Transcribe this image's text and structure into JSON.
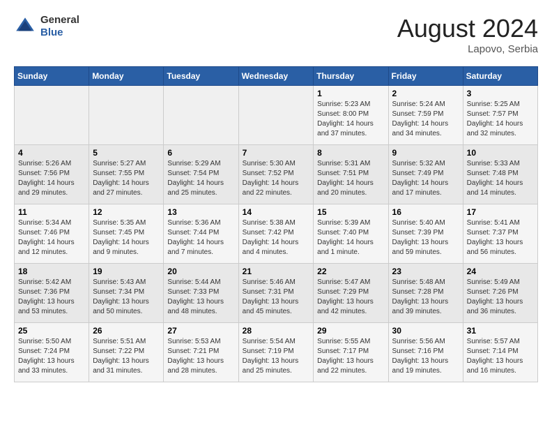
{
  "header": {
    "logo_general": "General",
    "logo_blue": "Blue",
    "month_year": "August 2024",
    "location": "Lapovo, Serbia"
  },
  "weekdays": [
    "Sunday",
    "Monday",
    "Tuesday",
    "Wednesday",
    "Thursday",
    "Friday",
    "Saturday"
  ],
  "weeks": [
    [
      {
        "day": "",
        "details": ""
      },
      {
        "day": "",
        "details": ""
      },
      {
        "day": "",
        "details": ""
      },
      {
        "day": "",
        "details": ""
      },
      {
        "day": "1",
        "details": "Sunrise: 5:23 AM\nSunset: 8:00 PM\nDaylight: 14 hours\nand 37 minutes."
      },
      {
        "day": "2",
        "details": "Sunrise: 5:24 AM\nSunset: 7:59 PM\nDaylight: 14 hours\nand 34 minutes."
      },
      {
        "day": "3",
        "details": "Sunrise: 5:25 AM\nSunset: 7:57 PM\nDaylight: 14 hours\nand 32 minutes."
      }
    ],
    [
      {
        "day": "4",
        "details": "Sunrise: 5:26 AM\nSunset: 7:56 PM\nDaylight: 14 hours\nand 29 minutes."
      },
      {
        "day": "5",
        "details": "Sunrise: 5:27 AM\nSunset: 7:55 PM\nDaylight: 14 hours\nand 27 minutes."
      },
      {
        "day": "6",
        "details": "Sunrise: 5:29 AM\nSunset: 7:54 PM\nDaylight: 14 hours\nand 25 minutes."
      },
      {
        "day": "7",
        "details": "Sunrise: 5:30 AM\nSunset: 7:52 PM\nDaylight: 14 hours\nand 22 minutes."
      },
      {
        "day": "8",
        "details": "Sunrise: 5:31 AM\nSunset: 7:51 PM\nDaylight: 14 hours\nand 20 minutes."
      },
      {
        "day": "9",
        "details": "Sunrise: 5:32 AM\nSunset: 7:49 PM\nDaylight: 14 hours\nand 17 minutes."
      },
      {
        "day": "10",
        "details": "Sunrise: 5:33 AM\nSunset: 7:48 PM\nDaylight: 14 hours\nand 14 minutes."
      }
    ],
    [
      {
        "day": "11",
        "details": "Sunrise: 5:34 AM\nSunset: 7:46 PM\nDaylight: 14 hours\nand 12 minutes."
      },
      {
        "day": "12",
        "details": "Sunrise: 5:35 AM\nSunset: 7:45 PM\nDaylight: 14 hours\nand 9 minutes."
      },
      {
        "day": "13",
        "details": "Sunrise: 5:36 AM\nSunset: 7:44 PM\nDaylight: 14 hours\nand 7 minutes."
      },
      {
        "day": "14",
        "details": "Sunrise: 5:38 AM\nSunset: 7:42 PM\nDaylight: 14 hours\nand 4 minutes."
      },
      {
        "day": "15",
        "details": "Sunrise: 5:39 AM\nSunset: 7:40 PM\nDaylight: 14 hours\nand 1 minute."
      },
      {
        "day": "16",
        "details": "Sunrise: 5:40 AM\nSunset: 7:39 PM\nDaylight: 13 hours\nand 59 minutes."
      },
      {
        "day": "17",
        "details": "Sunrise: 5:41 AM\nSunset: 7:37 PM\nDaylight: 13 hours\nand 56 minutes."
      }
    ],
    [
      {
        "day": "18",
        "details": "Sunrise: 5:42 AM\nSunset: 7:36 PM\nDaylight: 13 hours\nand 53 minutes."
      },
      {
        "day": "19",
        "details": "Sunrise: 5:43 AM\nSunset: 7:34 PM\nDaylight: 13 hours\nand 50 minutes."
      },
      {
        "day": "20",
        "details": "Sunrise: 5:44 AM\nSunset: 7:33 PM\nDaylight: 13 hours\nand 48 minutes."
      },
      {
        "day": "21",
        "details": "Sunrise: 5:46 AM\nSunset: 7:31 PM\nDaylight: 13 hours\nand 45 minutes."
      },
      {
        "day": "22",
        "details": "Sunrise: 5:47 AM\nSunset: 7:29 PM\nDaylight: 13 hours\nand 42 minutes."
      },
      {
        "day": "23",
        "details": "Sunrise: 5:48 AM\nSunset: 7:28 PM\nDaylight: 13 hours\nand 39 minutes."
      },
      {
        "day": "24",
        "details": "Sunrise: 5:49 AM\nSunset: 7:26 PM\nDaylight: 13 hours\nand 36 minutes."
      }
    ],
    [
      {
        "day": "25",
        "details": "Sunrise: 5:50 AM\nSunset: 7:24 PM\nDaylight: 13 hours\nand 33 minutes."
      },
      {
        "day": "26",
        "details": "Sunrise: 5:51 AM\nSunset: 7:22 PM\nDaylight: 13 hours\nand 31 minutes."
      },
      {
        "day": "27",
        "details": "Sunrise: 5:53 AM\nSunset: 7:21 PM\nDaylight: 13 hours\nand 28 minutes."
      },
      {
        "day": "28",
        "details": "Sunrise: 5:54 AM\nSunset: 7:19 PM\nDaylight: 13 hours\nand 25 minutes."
      },
      {
        "day": "29",
        "details": "Sunrise: 5:55 AM\nSunset: 7:17 PM\nDaylight: 13 hours\nand 22 minutes."
      },
      {
        "day": "30",
        "details": "Sunrise: 5:56 AM\nSunset: 7:16 PM\nDaylight: 13 hours\nand 19 minutes."
      },
      {
        "day": "31",
        "details": "Sunrise: 5:57 AM\nSunset: 7:14 PM\nDaylight: 13 hours\nand 16 minutes."
      }
    ]
  ]
}
